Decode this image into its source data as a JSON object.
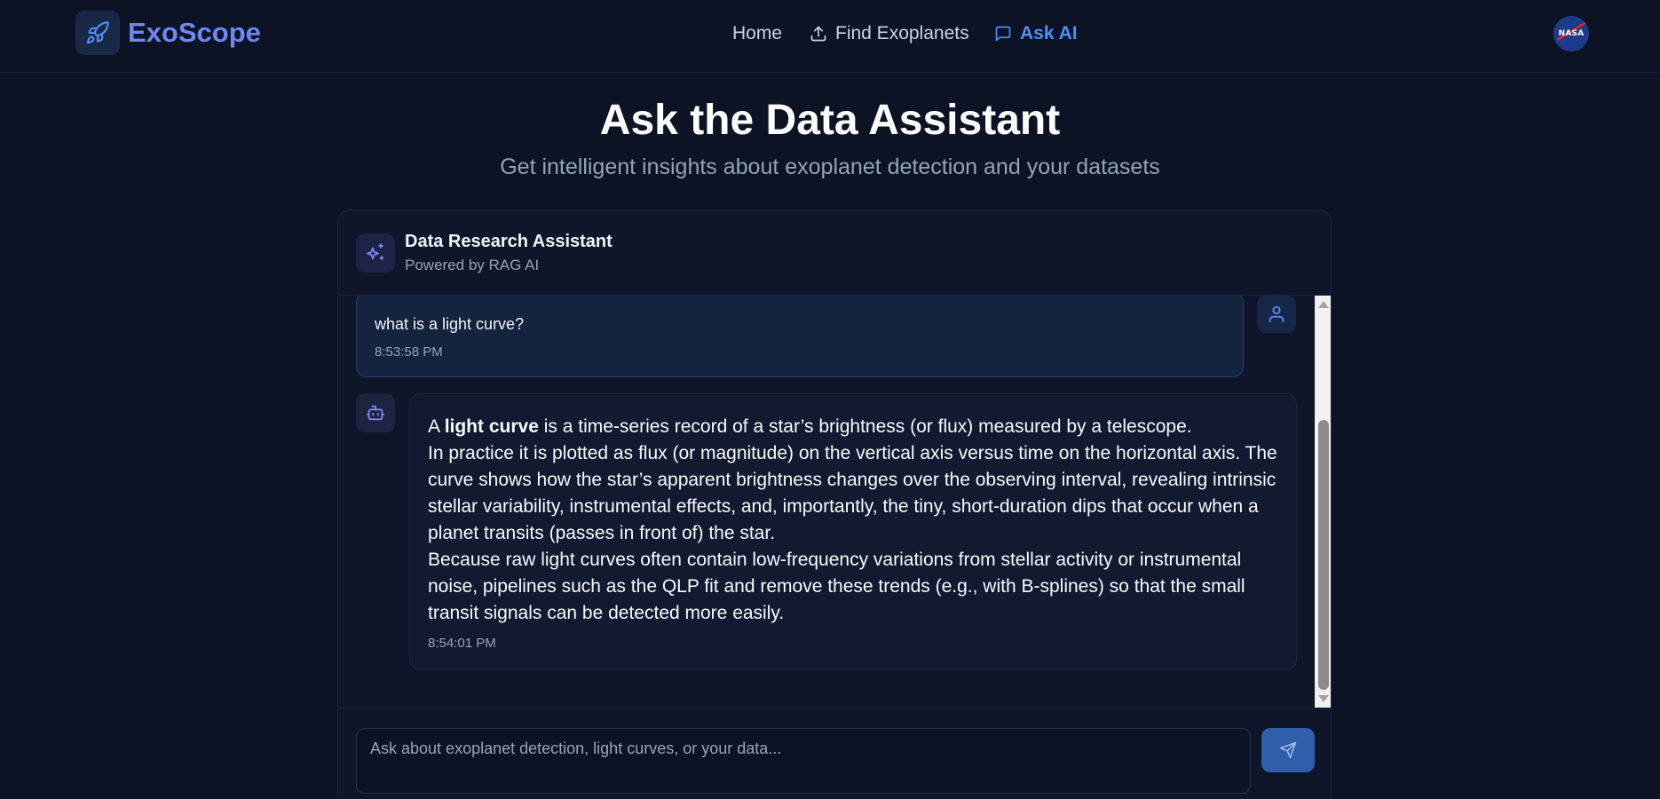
{
  "navbar": {
    "brand": "ExoScope",
    "links": [
      {
        "label": "Home",
        "icon": "none"
      },
      {
        "label": "Find Exoplanets",
        "icon": "upload-icon"
      },
      {
        "label": "Ask AI",
        "icon": "chat-icon",
        "active": true
      }
    ],
    "logo_icon": "rocket-icon",
    "partner_badge": "NASA"
  },
  "hero": {
    "title": "Ask the Data Assistant",
    "subtitle": "Get intelligent insights about exoplanet detection and your datasets"
  },
  "chat": {
    "assistant_name": "Data Research Assistant",
    "assistant_sub": "Powered by RAG AI",
    "messages": [
      {
        "role": "user",
        "text": "what is a light curve?",
        "time": "8:53:58 PM"
      },
      {
        "role": "assistant",
        "intro_a": "A ",
        "intro_bold": "light curve",
        "intro_b": " is a time-series record of a star’s brightness (or flux) measured by a telescope.",
        "para2": "In practice it is plotted as flux (or magnitude) on the vertical axis versus time on the horizontal axis. The curve shows how the star’s apparent brightness changes over the observing interval, revealing intrinsic stellar variability, instrumental effects, and, importantly, the tiny, short-duration dips that occur when a planet transits (passes in front of) the star.",
        "para3": "Because raw light curves often contain low-frequency variations from stellar activity or instrumental noise, pipelines such as the QLP fit and remove these trends (e.g., with B-splines) so that the small transit signals can be detected more easily.",
        "time": "8:54:01 PM"
      }
    ],
    "input_placeholder": "Ask about exoplanet detection, light curves, or your data...",
    "input_value": ""
  },
  "colors": {
    "background": "#0b1325",
    "accent": "#4f8ff7",
    "brand": "#6f86f4",
    "send_button": "#2f5eab"
  }
}
